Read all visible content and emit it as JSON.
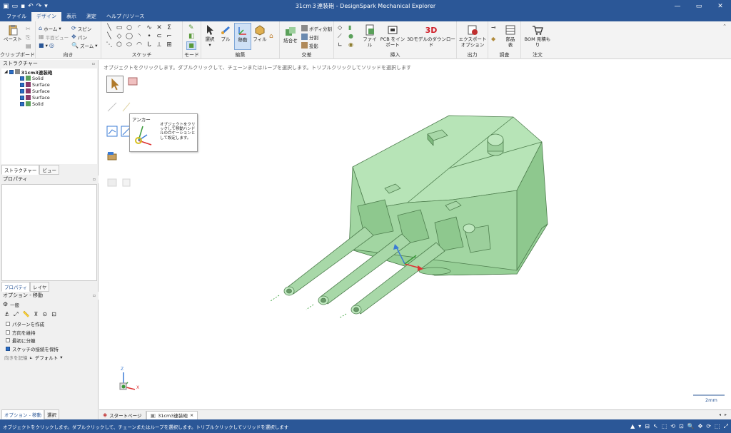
{
  "app": {
    "title": "31cm３連装砲 - DesignSpark Mechanical Explorer"
  },
  "ribbon_tabs": [
    "ファイル",
    "デザイン",
    "表示",
    "測定",
    "ヘルプ /リソース"
  ],
  "ribbon": {
    "clipboard": {
      "paste": "ペースト",
      "label": "クリップボード"
    },
    "orient": {
      "home": "ホーム",
      "plane_view": "平面ビュー",
      "spin": "スピン",
      "pan": "パン",
      "zoom": "ズーム",
      "label": "向き"
    },
    "sketch": {
      "label": "スケッチ"
    },
    "mode": {
      "label": "モード"
    },
    "edit": {
      "select": "選択",
      "pull": "プル",
      "move": "移動",
      "fill": "フィル",
      "label": "編集"
    },
    "intersect": {
      "combine": "結合せ",
      "split_body": "ボディ分割",
      "split": "分割",
      "project": "投影",
      "label": "交差"
    },
    "insert": {
      "file": "ファイル",
      "pcb": "PCB をイン\nポート",
      "download3d": "3Dモデルのダウンロード",
      "label": "挿入"
    },
    "output": {
      "export": "エクスポート\nオプション",
      "label": "出力"
    },
    "investigate": {
      "parts_table": "部品\n表",
      "label": "調査"
    },
    "order": {
      "bom": "BOM 見積も\nり",
      "label": "注文"
    }
  },
  "structure": {
    "header": "ストラクチャー",
    "root": "31cm3連装砲",
    "items": [
      "Solid",
      "Surface",
      "Surface",
      "Surface",
      "Solid"
    ],
    "tabs": [
      "ストラクチャー",
      "ビュー"
    ]
  },
  "properties": {
    "header": "プロパティ",
    "tabs": [
      "プロパティ",
      "レイヤ"
    ]
  },
  "options": {
    "header": "オプション - 移動",
    "general": "一般",
    "checks": [
      {
        "label": "パターンを作成",
        "checked": false
      },
      {
        "label": "方向を維持",
        "checked": false
      },
      {
        "label": "最初に分離",
        "checked": false
      },
      {
        "label": "スケッチの接続を保持",
        "checked": true
      }
    ],
    "direction_label": "向きを記憶",
    "direction_value": "デフォルト",
    "bottom_tabs": [
      "オプション - 移動",
      "選択"
    ]
  },
  "viewport": {
    "hint": "オブジェクトをクリックします。ダブルクリックして、チェーンまたはループを選択します。トリプルクリックしてソリッドを選択します",
    "tooltip_title": "アンカー",
    "tooltip_text": "オブジェクトをクリックして移動ハンドルのロケーションとして設定します。",
    "scale": "2mm",
    "axis": {
      "z": "Z",
      "x": "X"
    }
  },
  "doc_tabs": [
    "スタートページ",
    "31cm3連装砲"
  ],
  "status": {
    "text": "オブジェクトをクリックします。ダブルクリックして、チェーンまたはループを選択します。トリプルクリックしてソリッドを選択します"
  },
  "colors": {
    "titlebar": "#2b5797",
    "model_fill": "#a8dba8",
    "model_edge": "#4e7e4e"
  }
}
